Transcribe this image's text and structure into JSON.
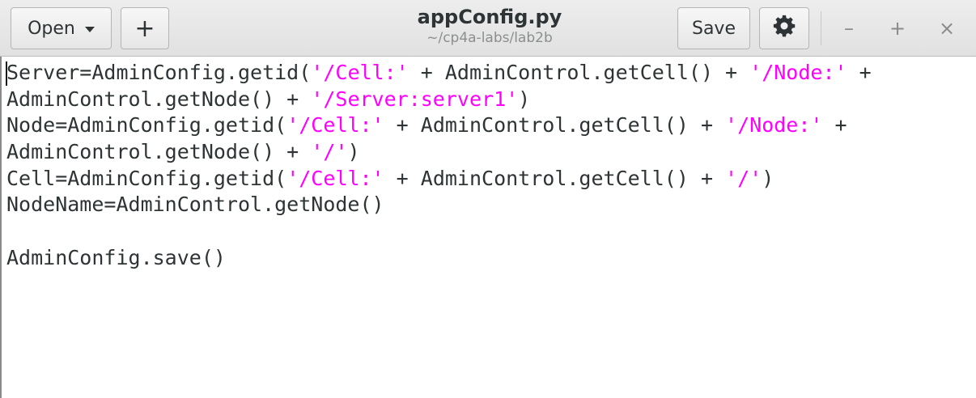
{
  "header": {
    "open_label": "Open",
    "new_tab_symbol": "+",
    "title": "appConfig.py",
    "subtitle": "~/cp4a-labs/lab2b",
    "save_label": "Save",
    "settings_icon": "gear-icon",
    "minimize_symbol": "–",
    "maximize_symbol": "+",
    "close_symbol": "×"
  },
  "colors": {
    "string_literal": "#ff00ff",
    "text": "#2e3436"
  },
  "editor": {
    "lines": [
      [
        {
          "t": "Server=AdminConfig.getid("
        },
        {
          "t": "'/Cell:'",
          "s": 1
        },
        {
          "t": " + AdminControl.getCell() + "
        },
        {
          "t": "'/Node:'",
          "s": 1
        },
        {
          "t": " +"
        }
      ],
      [
        {
          "t": "AdminControl.getNode() + "
        },
        {
          "t": "'/Server:server1'",
          "s": 1
        },
        {
          "t": ")"
        }
      ],
      [
        {
          "t": "Node=AdminConfig.getid("
        },
        {
          "t": "'/Cell:'",
          "s": 1
        },
        {
          "t": " + AdminControl.getCell() + "
        },
        {
          "t": "'/Node:'",
          "s": 1
        },
        {
          "t": " +"
        }
      ],
      [
        {
          "t": "AdminControl.getNode() + "
        },
        {
          "t": "'/'",
          "s": 1
        },
        {
          "t": ")"
        }
      ],
      [
        {
          "t": "Cell=AdminConfig.getid("
        },
        {
          "t": "'/Cell:'",
          "s": 1
        },
        {
          "t": " + AdminControl.getCell() + "
        },
        {
          "t": "'/'",
          "s": 1
        },
        {
          "t": ")"
        }
      ],
      [
        {
          "t": "NodeName=AdminControl.getNode()"
        }
      ],
      [
        {
          "t": ""
        }
      ],
      [
        {
          "t": "AdminConfig.save()"
        }
      ]
    ]
  }
}
